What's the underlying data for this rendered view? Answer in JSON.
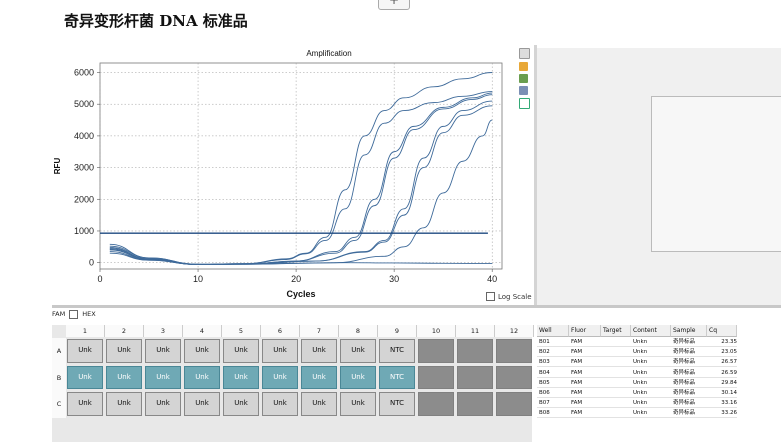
{
  "page": {
    "title": "奇异变形杆菌 DNA 标准品",
    "plus_label": "+"
  },
  "chart_data": {
    "type": "line",
    "title": "Amplification",
    "xlabel": "Cycles",
    "ylabel": "RFU",
    "xlim": [
      0,
      41
    ],
    "ylim": [
      -200,
      6300
    ],
    "xticks": [
      0,
      10,
      20,
      30,
      40
    ],
    "yticks": [
      0,
      1000,
      2000,
      3000,
      4000,
      5000,
      6000
    ],
    "threshold": 930,
    "grid": true,
    "series": [
      {
        "values": [
          [
            1,
            520
          ],
          [
            5,
            150
          ],
          [
            10,
            -50
          ],
          [
            15,
            -30
          ],
          [
            19,
            120
          ],
          [
            21,
            300
          ],
          [
            23,
            800
          ],
          [
            25,
            2300
          ],
          [
            27,
            4000
          ],
          [
            29,
            4800
          ],
          [
            31,
            5200
          ],
          [
            34,
            5550
          ],
          [
            37,
            5800
          ],
          [
            40,
            6000
          ]
        ]
      },
      {
        "values": [
          [
            1,
            580
          ],
          [
            5,
            150
          ],
          [
            10,
            -50
          ],
          [
            15,
            -30
          ],
          [
            19,
            100
          ],
          [
            21,
            280
          ],
          [
            23,
            700
          ],
          [
            25,
            1700
          ],
          [
            27,
            3400
          ],
          [
            29,
            4400
          ],
          [
            31,
            4800
          ],
          [
            34,
            5050
          ],
          [
            37,
            5250
          ],
          [
            40,
            5400
          ]
        ]
      },
      {
        "values": [
          [
            1,
            480
          ],
          [
            5,
            120
          ],
          [
            10,
            -60
          ],
          [
            15,
            -40
          ],
          [
            20,
            50
          ],
          [
            24,
            350
          ],
          [
            26,
            800
          ],
          [
            28,
            2000
          ],
          [
            30,
            3500
          ],
          [
            32,
            4300
          ],
          [
            35,
            4900
          ],
          [
            38,
            5200
          ],
          [
            40,
            5350
          ]
        ]
      },
      {
        "values": [
          [
            1,
            450
          ],
          [
            5,
            120
          ],
          [
            10,
            -60
          ],
          [
            15,
            -40
          ],
          [
            20,
            50
          ],
          [
            24,
            300
          ],
          [
            26,
            700
          ],
          [
            28,
            1800
          ],
          [
            30,
            3300
          ],
          [
            32,
            4200
          ],
          [
            35,
            4850
          ],
          [
            38,
            5150
          ],
          [
            40,
            5300
          ]
        ]
      },
      {
        "values": [
          [
            1,
            420
          ],
          [
            5,
            100
          ],
          [
            10,
            -60
          ],
          [
            15,
            -40
          ],
          [
            22,
            50
          ],
          [
            27,
            350
          ],
          [
            29,
            700
          ],
          [
            31,
            1700
          ],
          [
            33,
            3300
          ],
          [
            35,
            4300
          ],
          [
            37,
            4800
          ],
          [
            40,
            5100
          ]
        ]
      },
      {
        "values": [
          [
            1,
            400
          ],
          [
            5,
            100
          ],
          [
            10,
            -60
          ],
          [
            15,
            -40
          ],
          [
            22,
            50
          ],
          [
            27,
            330
          ],
          [
            29,
            650
          ],
          [
            31,
            1500
          ],
          [
            33,
            3000
          ],
          [
            35,
            4100
          ],
          [
            37,
            4650
          ],
          [
            40,
            4950
          ]
        ]
      },
      {
        "values": [
          [
            1,
            350
          ],
          [
            5,
            80
          ],
          [
            10,
            -60
          ],
          [
            15,
            -50
          ],
          [
            24,
            0
          ],
          [
            29,
            200
          ],
          [
            31,
            500
          ],
          [
            33,
            1100
          ],
          [
            35,
            2200
          ],
          [
            37,
            3200
          ],
          [
            39,
            4000
          ],
          [
            40,
            4500
          ]
        ]
      },
      {
        "values": [
          [
            1,
            300
          ],
          [
            5,
            80
          ],
          [
            10,
            -60
          ],
          [
            15,
            -50
          ],
          [
            20,
            -20
          ],
          [
            25,
            0
          ],
          [
            30,
            -10
          ],
          [
            35,
            -20
          ],
          [
            40,
            -30
          ]
        ]
      }
    ],
    "colors": {
      "line": "#3e6a9a",
      "threshold": "#1e4a80"
    }
  },
  "log_scale_label": "Log Scale",
  "fluors": [
    {
      "label": "FAM"
    },
    {
      "label": "HEX"
    }
  ],
  "plate": {
    "columns": [
      "1",
      "2",
      "3",
      "4",
      "5",
      "6",
      "7",
      "8",
      "9",
      "10",
      "11",
      "12"
    ],
    "rows": [
      {
        "label": "A",
        "wells": [
          "Unk",
          "Unk",
          "Unk",
          "Unk",
          "Unk",
          "Unk",
          "Unk",
          "Unk",
          "NTC",
          "",
          "",
          ""
        ]
      },
      {
        "label": "B",
        "wells": [
          "Unk",
          "Unk",
          "Unk",
          "Unk",
          "Unk",
          "Unk",
          "Unk",
          "Unk",
          "NTC",
          "",
          "",
          ""
        ]
      },
      {
        "label": "C",
        "wells": [
          "Unk",
          "Unk",
          "Unk",
          "Unk",
          "Unk",
          "Unk",
          "Unk",
          "Unk",
          "NTC",
          "",
          "",
          ""
        ]
      }
    ]
  },
  "table": {
    "headers": [
      "Well",
      "Fluor",
      "Target",
      "Content",
      "Sample",
      "Cq"
    ],
    "rows": [
      [
        "B01",
        "FAM",
        "",
        "Unkn",
        "奇异标品",
        "23.35"
      ],
      [
        "B02",
        "FAM",
        "",
        "Unkn",
        "奇异标品",
        "23.05"
      ],
      [
        "B03",
        "FAM",
        "",
        "Unkn",
        "奇异标品",
        "26.57"
      ],
      [
        "B04",
        "FAM",
        "",
        "Unkn",
        "奇异标品",
        "26.59"
      ],
      [
        "B05",
        "FAM",
        "",
        "Unkn",
        "奇异标品",
        "29.84"
      ],
      [
        "B06",
        "FAM",
        "",
        "Unkn",
        "奇异标品",
        "30.14"
      ],
      [
        "B07",
        "FAM",
        "",
        "Unkn",
        "奇异标品",
        "33.16"
      ],
      [
        "B08",
        "FAM",
        "",
        "Unkn",
        "奇异标品",
        "33.26"
      ]
    ]
  }
}
